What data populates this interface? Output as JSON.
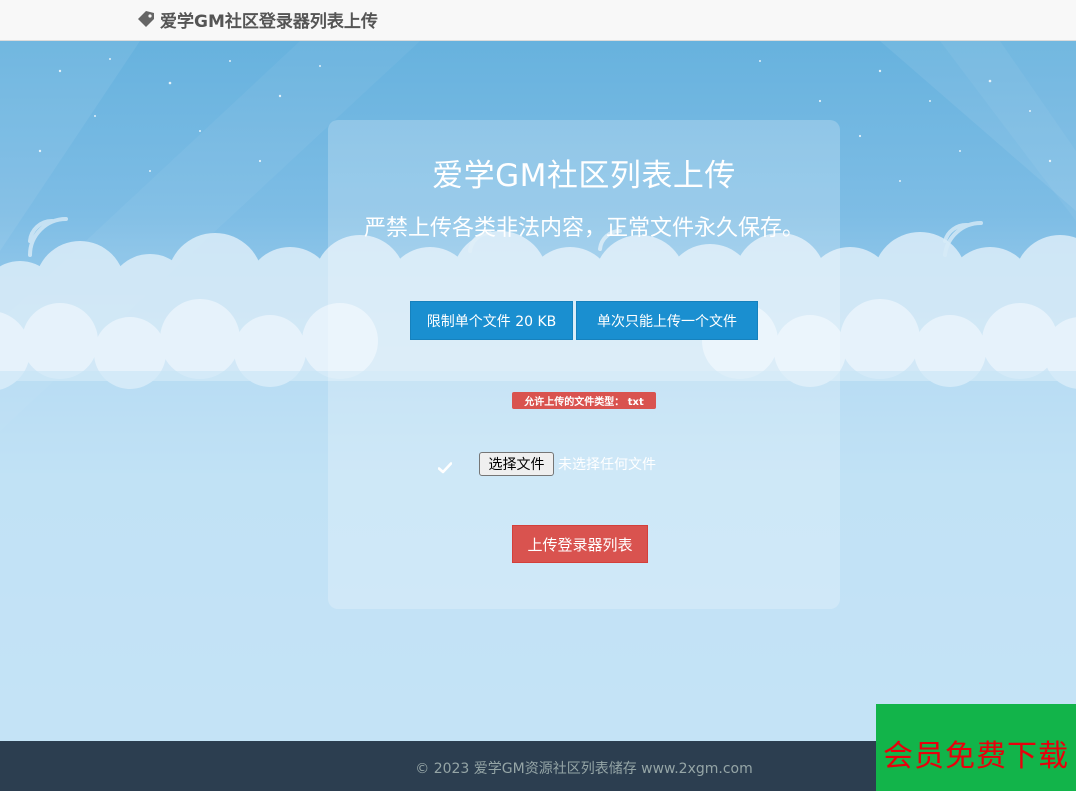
{
  "navbar": {
    "brand_label": "爱学GM社区登录器列表上传",
    "brand_icon": "tag-icon"
  },
  "panel": {
    "title": "爱学GM社区列表上传",
    "subtitle": "严禁上传各类非法内容，正常文件永久保存。",
    "info_buttons": [
      {
        "label": "限制单个文件 20 KB"
      },
      {
        "label": "单次只能上传一个文件"
      }
    ],
    "allowed_types_badge": "允许上传的文件类型： txt",
    "file_input": {
      "button_label": "选择文件",
      "status": "未选择任何文件"
    },
    "submit_label": "上传登录器列表"
  },
  "footer": {
    "text": "© 2023 爱学GM资源社区列表储存 www.2xgm.com"
  },
  "promo": {
    "label": "会员免费下载"
  },
  "colors": {
    "primary_button": "#1a8fd0",
    "danger": "#d9534f",
    "footer_bg": "#2c3e50",
    "promo_bg": "#12b44a",
    "promo_text": "#e8000c"
  }
}
